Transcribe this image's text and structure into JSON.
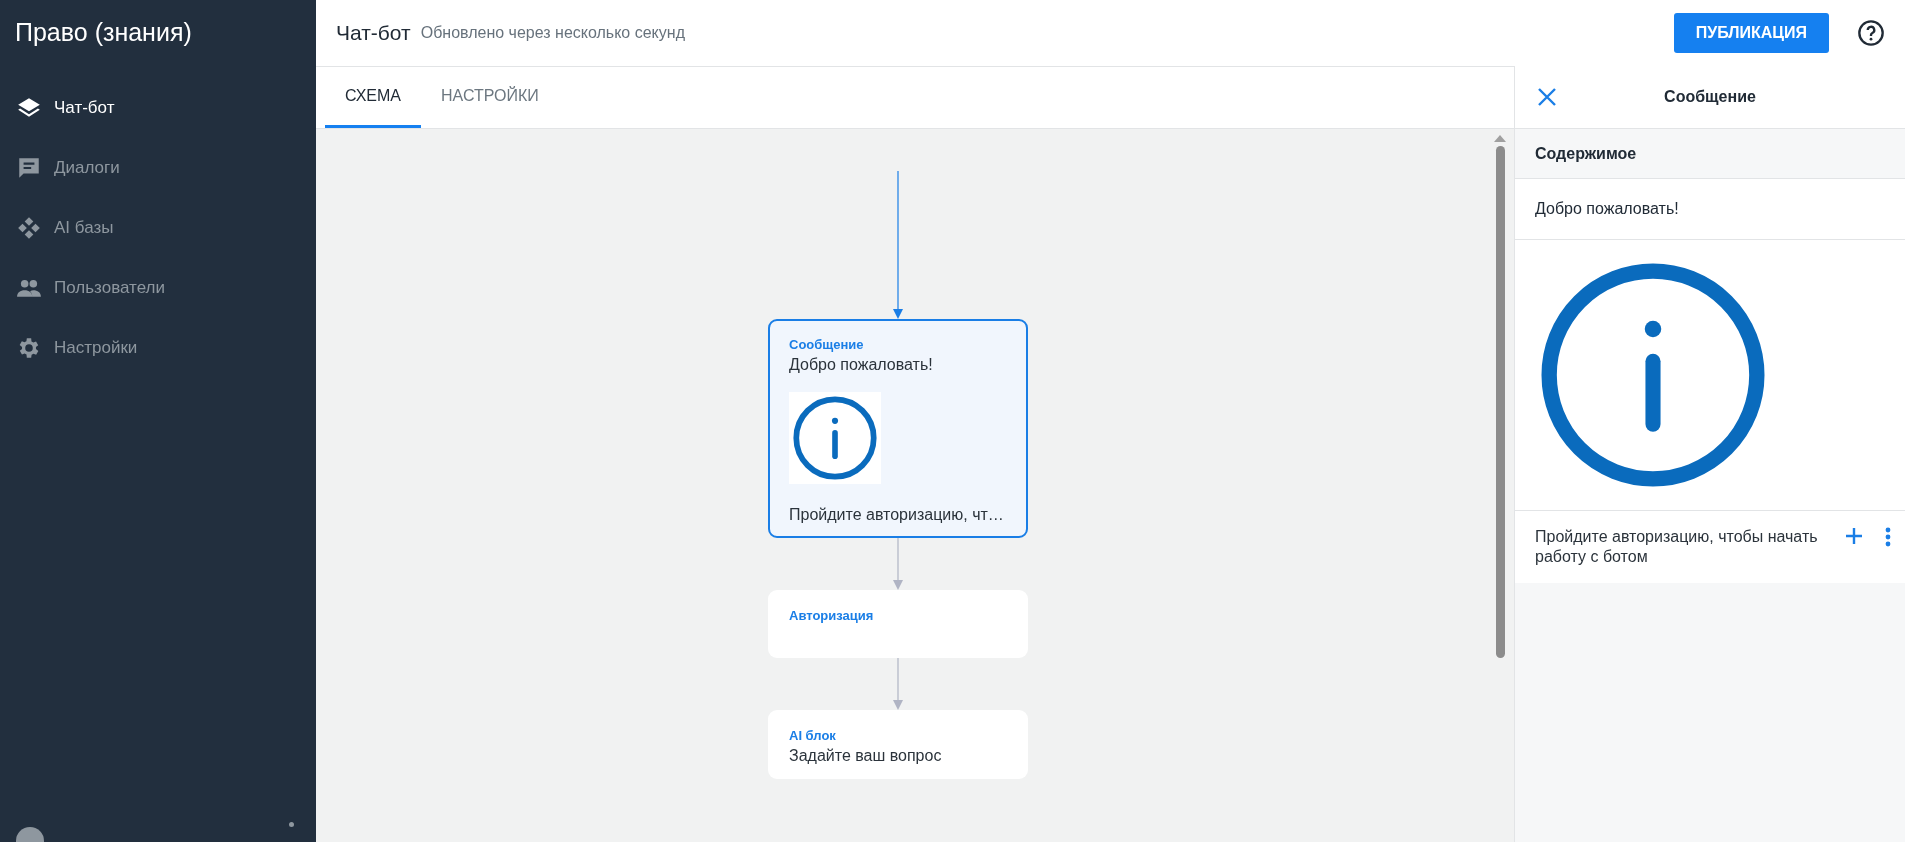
{
  "sidebar": {
    "title": "Право (знания)",
    "items": [
      {
        "label": "Чат-бот",
        "selected": true
      },
      {
        "label": "Диалоги",
        "selected": false
      },
      {
        "label": "AI базы",
        "selected": false
      },
      {
        "label": "Пользователи",
        "selected": false
      },
      {
        "label": "Настройки",
        "selected": false
      }
    ]
  },
  "header": {
    "title": "Чат-бот",
    "subtitle": "Обновлено через несколько секунд",
    "publish_button": "ПУБЛИКАЦИЯ"
  },
  "tabs": [
    {
      "label": "СХЕМА",
      "selected": true
    },
    {
      "label": "НАСТРОЙКИ",
      "selected": false
    }
  ],
  "flow": {
    "nodes": [
      {
        "kind": "message",
        "type": "Сообщение",
        "text": "Добро пожаловать!",
        "caption": "Пройдите авторизацию, чт…",
        "selected": true
      },
      {
        "kind": "auth",
        "type": "Авторизация",
        "selected": false
      },
      {
        "kind": "ai",
        "type": "AI блок",
        "text": "Задайте ваш вопрос",
        "selected": false
      }
    ]
  },
  "panel": {
    "title": "Сообщение",
    "section": "Содержимое",
    "text": "Добро пожаловать!",
    "caption": "Пройдите авторизацию, чтобы начать работу с ботом"
  }
}
